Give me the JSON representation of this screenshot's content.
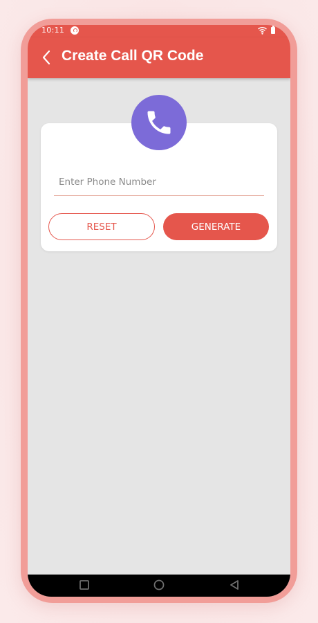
{
  "status_bar": {
    "time": "10:11",
    "app_icon": "help-circle-icon",
    "wifi_icon": "wifi-icon",
    "battery_icon": "battery-icon"
  },
  "app_bar": {
    "back_icon": "chevron-left-icon",
    "title": "Create Call QR Code"
  },
  "form": {
    "badge_icon": "phone-icon",
    "phone_placeholder": "Enter Phone Number",
    "phone_value": "",
    "reset_label": "RESET",
    "generate_label": "GENERATE"
  },
  "nav_bar": {
    "recents_icon": "square-icon",
    "home_icon": "circle-icon",
    "back_icon": "triangle-back-icon"
  },
  "colors": {
    "accent": "#e5564c",
    "badge": "#7c6bd8",
    "frame": "#f19d98",
    "screen_background": "#e5e5e5"
  }
}
